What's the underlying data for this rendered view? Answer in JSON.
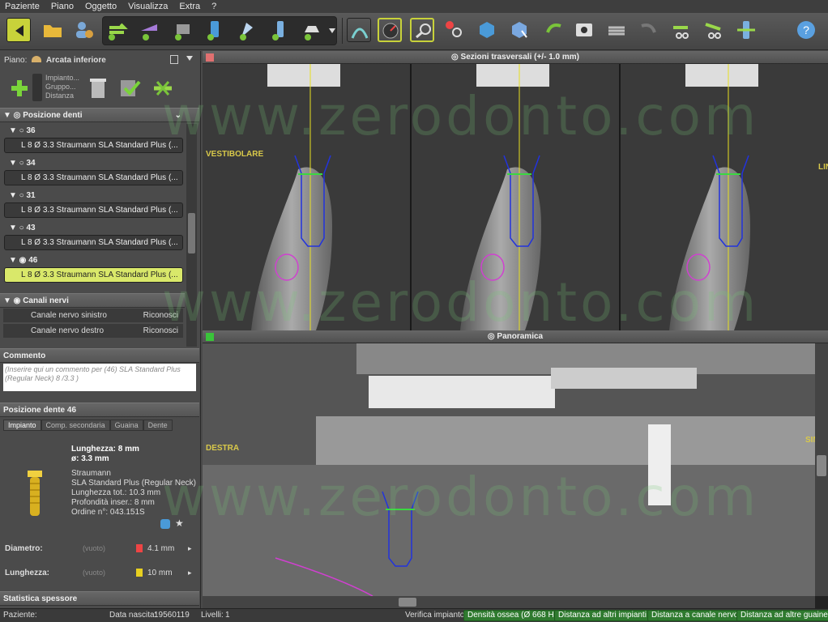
{
  "menu": [
    "Paziente",
    "Piano",
    "Oggetto",
    "Visualizza",
    "Extra",
    "?"
  ],
  "plane": {
    "label": "Piano:",
    "value": "Arcata inferiore"
  },
  "actions": {
    "implant": "Impianto...",
    "group": "Gruppo...",
    "distance": "Distanza"
  },
  "teeth_header": "Posizione denti",
  "teeth": [
    {
      "id": "36",
      "implant": "L 8  Ø 3.3   Straumann SLA Standard Plus (..."
    },
    {
      "id": "34",
      "implant": "L 8  Ø 3.3   Straumann SLA Standard Plus (..."
    },
    {
      "id": "31",
      "implant": "L 8  Ø 3.3   Straumann SLA Standard Plus (..."
    },
    {
      "id": "43",
      "implant": "L 8  Ø 3.3   Straumann SLA Standard Plus (..."
    },
    {
      "id": "46",
      "implant": "L 8  Ø 3.3   Straumann SLA Standard Plus (..."
    }
  ],
  "nerves": {
    "header": "Canali nervi",
    "left": "Canale nervo sinistro",
    "right": "Canale nervo destro",
    "recognize": "Riconosci"
  },
  "comment": {
    "header": "Commento",
    "text": "(Inserire qui un commento per (46) SLA Standard Plus (Regular Neck) 8 /3.3 )"
  },
  "position": {
    "header": "Posizione dente 46",
    "tabs": [
      "Impianto",
      "Comp. secondaria",
      "Guaina",
      "Dente"
    ],
    "length": "Lunghezza: 8 mm",
    "diameter": "ø: 3.3 mm",
    "details": [
      "Straumann",
      "SLA Standard Plus (Regular Neck)",
      "Lunghezza tot.: 10.3 mm",
      "Profondità inser.: 8 mm",
      "Ordine n°: 043.151S"
    ],
    "diam_label": "Diametro:",
    "len_label": "Lunghezza:",
    "empty": "(vuoto)",
    "diam_val": "4.1 mm",
    "len_val": "10 mm"
  },
  "stats": "Statistica spessore",
  "views": {
    "cross": "Sezioni trasversali (+/- 1.0 mm)",
    "pano": "Panoramica",
    "vest": "VESTIBOLARE",
    "ling": "LINGUALE",
    "destra": "DESTRA",
    "sinistra": "SINISTRA",
    "watermark": "www.zerodonto.com"
  },
  "status": {
    "patient": "Paziente:",
    "birth_label": "Data nascita:",
    "birth": "19560119",
    "levels_label": "Livelli:",
    "levels": "1",
    "verify": "Verifica impianto:",
    "buttons": [
      "Densità ossea (Ø 668 H)",
      "Distanza ad altri impianti",
      "Distanza a canale nervo",
      "Distanza ad altre guaine"
    ]
  }
}
